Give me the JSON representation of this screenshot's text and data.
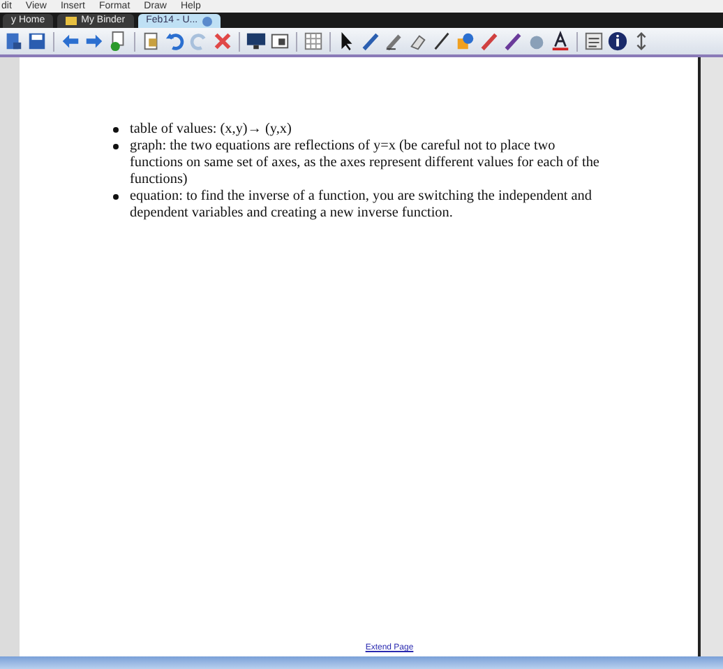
{
  "menu_bar": {
    "items": [
      "dit",
      "View",
      "Insert",
      "Format",
      "Draw",
      "Help"
    ]
  },
  "tabs": [
    {
      "label": "y Home",
      "selected": false,
      "kind": "home"
    },
    {
      "label": "My Binder",
      "selected": false,
      "kind": "folder"
    },
    {
      "label": "Feb14 - U...",
      "selected": true,
      "kind": "page"
    }
  ],
  "page": {
    "bullets": [
      "table of values: (x,y)→ (y,x)",
      "graph: the two equations are reflections of y=x (be careful not to place two functions on same set of axes, as the axes represent different values for each of the functions)",
      "equation: to find the inverse of a function, you are switching the independent and dependent variables and creating a new inverse function."
    ],
    "extend_link": "Extend Page"
  }
}
